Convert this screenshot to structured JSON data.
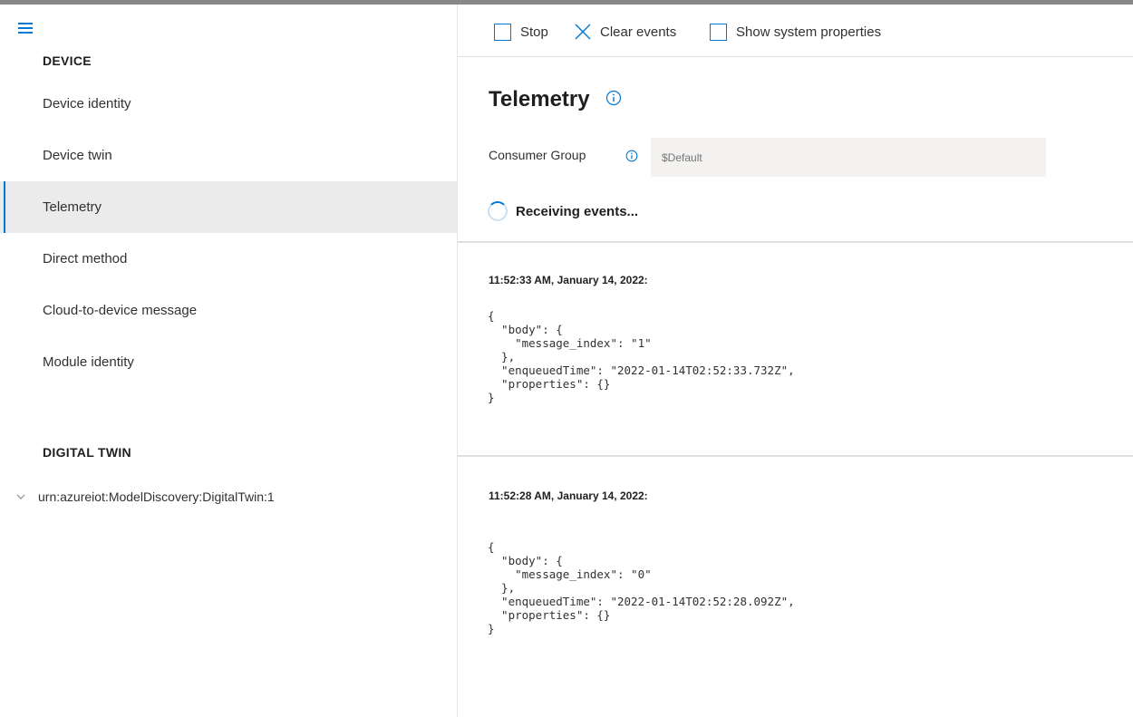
{
  "sidebar": {
    "device_section": "DEVICE",
    "items": [
      {
        "label": "Device identity"
      },
      {
        "label": "Device twin"
      },
      {
        "label": "Telemetry"
      },
      {
        "label": "Direct method"
      },
      {
        "label": "Cloud-to-device message"
      },
      {
        "label": "Module identity"
      }
    ],
    "selected_item": "Telemetry",
    "digital_twin_section": "DIGITAL TWIN",
    "digital_twin_item": "urn:azureiot:ModelDiscovery:DigitalTwin:1"
  },
  "commandbar": {
    "stop_label": "Stop",
    "clear_label": "Clear events",
    "show_system_label": "Show system properties"
  },
  "main": {
    "title": "Telemetry",
    "consumer_group_label": "Consumer Group",
    "consumer_group_placeholder": "$Default",
    "status": "Receiving events..."
  },
  "events": [
    {
      "time": "11:52:33 AM, January 14, 2022:",
      "body": "{\n  \"body\": {\n    \"message_index\": \"1\"\n  },\n  \"enqueuedTime\": \"2022-01-14T02:52:33.732Z\",\n  \"properties\": {}\n}"
    },
    {
      "time": "11:52:28 AM, January 14, 2022:",
      "body": "{\n  \"body\": {\n    \"message_index\": \"0\"\n  },\n  \"enqueuedTime\": \"2022-01-14T02:52:28.092Z\",\n  \"properties\": {}\n}"
    }
  ],
  "colors": {
    "accent": "#0078d4",
    "selected_bg": "#ebebeb",
    "input_bg": "#f3f2f1"
  },
  "icons": {
    "menu": "hamburger-icon",
    "stop": "checkbox-icon",
    "clear": "close-icon",
    "info": "info-icon",
    "expand": "chevron-down-icon",
    "status": "spinner-icon"
  }
}
